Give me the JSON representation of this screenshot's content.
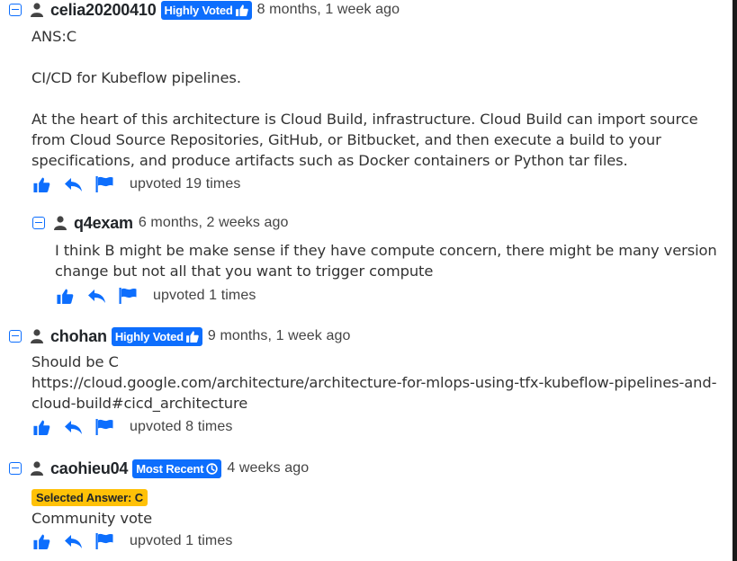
{
  "comments": [
    {
      "username": "celia20200410",
      "badge": "Highly Voted",
      "time": "8 months, 1 week ago",
      "lines": [
        "ANS:C",
        "",
        "CI/CD for Kubeflow pipelines.",
        "",
        "At the heart of this architecture is Cloud Build, infrastructure. Cloud Build can import source from Cloud Source Repositories, GitHub, or Bitbucket, and then execute a build to your specifications, and produce artifacts such as Docker containers or Python tar files."
      ],
      "votes": "upvoted 19 times"
    },
    {
      "username": "q4exam",
      "time": "6 months, 2 weeks ago",
      "lines": [
        "I think B might be make sense if they have compute concern, there might be many version change but not all that you want to trigger compute"
      ],
      "votes": "upvoted 1 times"
    },
    {
      "username": "chohan",
      "badge": "Highly Voted",
      "time": "9 months, 1 week ago",
      "lines": [
        "Should be C",
        "https://cloud.google.com/architecture/architecture-for-mlops-using-tfx-kubeflow-pipelines-and-cloud-build#cicd_architecture"
      ],
      "votes": "upvoted 8 times"
    },
    {
      "username": "caohieu04",
      "badge": "Most Recent",
      "time": "4 weeks ago",
      "selected_answer": "Selected Answer: C",
      "lines": [
        "Community vote"
      ],
      "votes": "upvoted 1 times"
    }
  ],
  "icons": {
    "collapse": "minus-square-icon",
    "user": "user-icon",
    "upvote": "thumbs-up-icon",
    "reply": "reply-icon",
    "report": "flag-icon",
    "highly_voted": "thumbs-up-icon",
    "most_recent": "clock-icon"
  },
  "colors": {
    "accent": "#0d6efd",
    "selected_badge": "#ffc107"
  }
}
